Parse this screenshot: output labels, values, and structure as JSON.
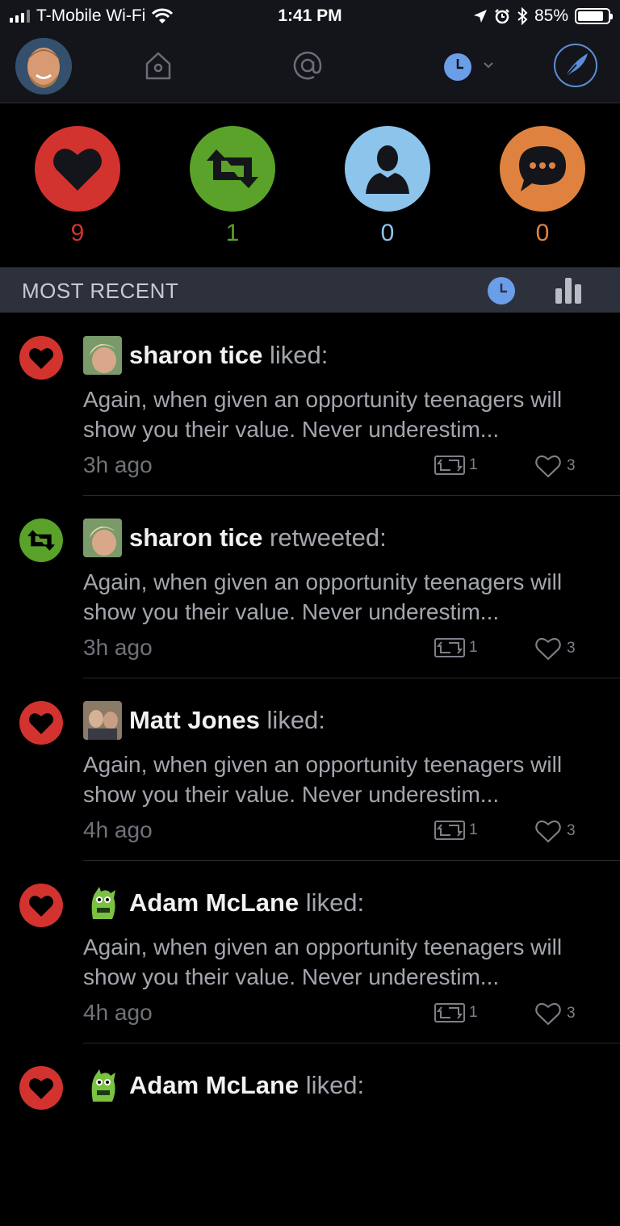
{
  "status_bar": {
    "carrier": "T-Mobile Wi-Fi",
    "time": "1:41 PM",
    "battery": "85%",
    "battery_level": 0.85
  },
  "nav": {
    "icons": [
      "home-icon",
      "mentions-icon",
      "clock-icon",
      "chevron-down-icon",
      "compose-icon"
    ]
  },
  "stats": {
    "likes": {
      "count": "9",
      "color": "#d2332f",
      "icon": "heart-icon"
    },
    "retweets": {
      "count": "1",
      "color": "#5aa22a",
      "icon": "retweet-icon"
    },
    "follows": {
      "count": "0",
      "color": "#8cc4ec",
      "icon": "person-icon"
    },
    "replies": {
      "count": "0",
      "color": "#e0823f",
      "icon": "speech-bubble-icon"
    }
  },
  "section": {
    "title": "MOST RECENT"
  },
  "activity": [
    {
      "type": "like",
      "user": "sharon tice",
      "action": "liked:",
      "text": "Again, when given an opportunity teenagers will show you their value. Never underestim...",
      "time": "3h ago",
      "retweets": "1",
      "likes": "3"
    },
    {
      "type": "retweet",
      "user": "sharon tice",
      "action": "retweeted:",
      "text": "Again, when given an opportunity teenagers will show you their value. Never underestim...",
      "time": "3h ago",
      "retweets": "1",
      "likes": "3"
    },
    {
      "type": "like",
      "user": "Matt Jones",
      "action": "liked:",
      "text": "Again, when given an opportunity teenagers will show you their value. Never underestim...",
      "time": "4h ago",
      "retweets": "1",
      "likes": "3"
    },
    {
      "type": "like",
      "user": "Adam McLane",
      "action": "liked:",
      "text": "Again, when given an opportunity teenagers will show you their value. Never underestim...",
      "time": "4h ago",
      "retweets": "1",
      "likes": "3"
    },
    {
      "type": "like",
      "user": "Adam McLane",
      "action": "liked:",
      "text": "",
      "time": "",
      "retweets": "",
      "likes": ""
    }
  ]
}
